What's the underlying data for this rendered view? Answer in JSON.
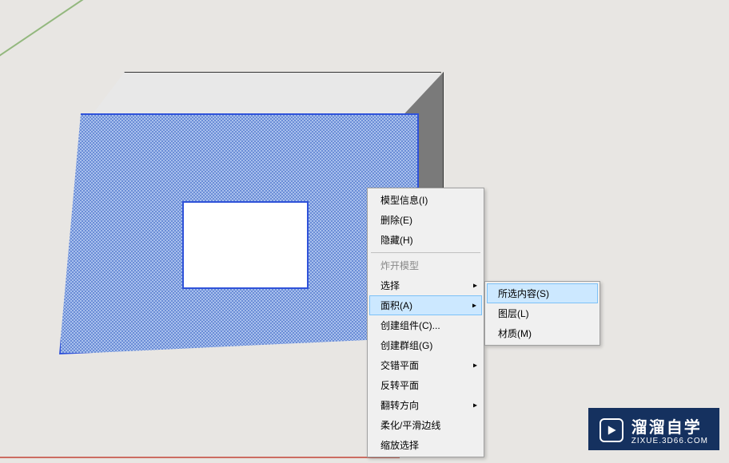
{
  "menu": {
    "model_info": "模型信息(I)",
    "delete": "删除(E)",
    "hide": "隐藏(H)",
    "explode": "炸开模型",
    "select": "选择",
    "area": "面积(A)",
    "create_component": "创建组件(C)...",
    "create_group": "创建群组(G)",
    "intersect_faces": "交错平面",
    "reverse_faces": "反转平面",
    "flip_along": "翻转方向",
    "soften_smooth": "柔化/平滑边线",
    "zoom_selection": "缩放选择"
  },
  "submenu": {
    "selection": "所选内容(S)",
    "layer": "图层(L)",
    "material": "材质(M)"
  },
  "watermark": {
    "title": "溜溜自学",
    "url": "ZIXUE.3D66.COM"
  }
}
